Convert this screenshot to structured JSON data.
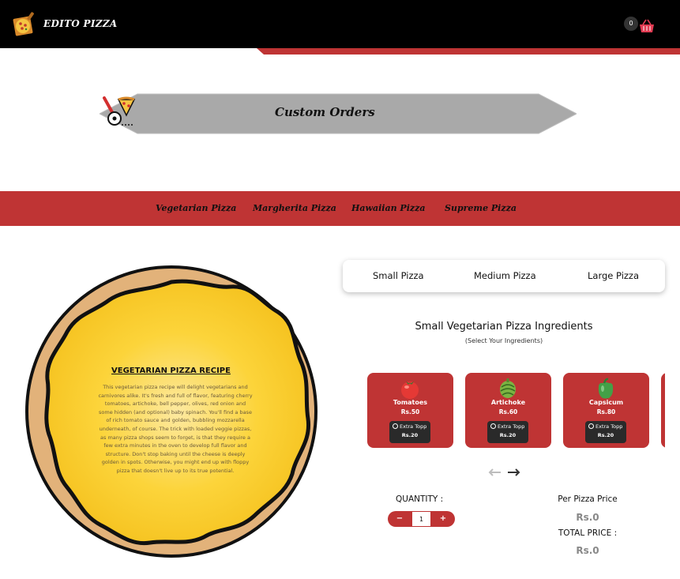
{
  "header": {
    "brand": "EDITO PIZZA",
    "logo_icon": "pizza-peel-icon",
    "cart_count": "0",
    "cart_icon": "shopping-basket-icon"
  },
  "banner": {
    "title": "Custom Orders",
    "icon": "pizza-cutter-icon"
  },
  "categories": [
    "Vegetarian Pizza",
    "Margherita Pizza",
    "Hawaiian Pizza",
    "Supreme Pizza"
  ],
  "recipe": {
    "title": "VEGETARIAN PIZZA RECIPE",
    "text": "This vegetarian pizza recipe will delight vegetarians and carnivores alike. It's fresh and full of flavor, featuring cherry tomatoes, artichoke, bell pepper, olives, red onion and some hidden (and optional) baby spinach. You'll find a base of rich tomato sauce and golden, bubbling mozzarella underneath, of course. The trick with loaded veggie pizzas, as many pizza shops seem to forget, is that they require a few extra minutes in the oven to develop full flavor and structure. Don't stop baking until the cheese is deeply golden in spots. Otherwise, you might end up with floppy pizza that doesn't live up to its true potential."
  },
  "sizes": [
    "Small Pizza",
    "Medium Pizza",
    "Large Pizza"
  ],
  "ingredients_section": {
    "title": "Small Vegetarian Pizza Ingredients",
    "subtitle": "(Select Your Ingredients)"
  },
  "ingredients": [
    {
      "name": "Tomatoes",
      "price": "Rs.50",
      "extra_label": "Extra Topp",
      "extra_price": "Rs.20",
      "icon": "tomato-icon"
    },
    {
      "name": "Artichoke",
      "price": "Rs.60",
      "extra_label": "Extra Topp",
      "extra_price": "Rs.20",
      "icon": "artichoke-icon"
    },
    {
      "name": "Capsicum",
      "price": "Rs.80",
      "extra_label": "Extra Topp",
      "extra_price": "Rs.20",
      "icon": "bell-pepper-icon"
    }
  ],
  "quantity": {
    "label": "QUANTITY :",
    "minus": "−",
    "value": "1",
    "plus": "+"
  },
  "pricing": {
    "per_label": "Per Pizza Price",
    "per_value": "Rs.0",
    "total_label": "TOTAL PRICE :",
    "total_value": "Rs.0"
  },
  "colors": {
    "accent_red": "#bf3434",
    "header_black": "#000000",
    "cheese_yellow": "#fcd02e",
    "crust": "#e2b27a"
  }
}
